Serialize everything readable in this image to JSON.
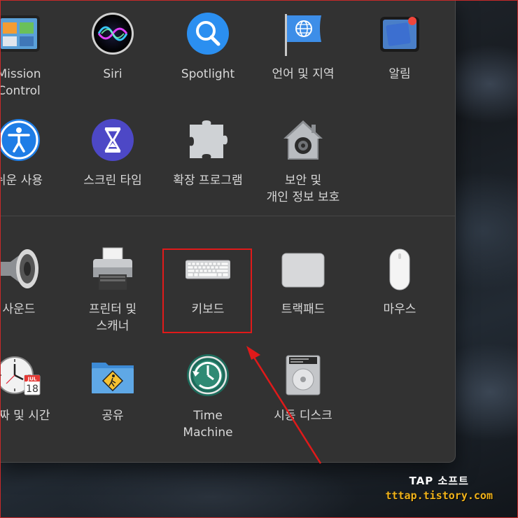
{
  "panes_row1": [
    {
      "label": "Mission\nControl",
      "icon": "mission-control-icon"
    },
    {
      "label": "Siri",
      "icon": "siri-icon"
    },
    {
      "label": "Spotlight",
      "icon": "spotlight-icon"
    },
    {
      "label": "언어 및 지역",
      "icon": "language-region-icon"
    },
    {
      "label": "알림",
      "icon": "notifications-icon"
    }
  ],
  "panes_row2": [
    {
      "label": "쉬운 사용",
      "icon": "accessibility-icon"
    },
    {
      "label": "스크린 타임",
      "icon": "screen-time-icon"
    },
    {
      "label": "확장 프로그램",
      "icon": "extensions-icon"
    },
    {
      "label": "보안 및\n개인 정보 보호",
      "icon": "security-privacy-icon"
    }
  ],
  "panes_row3": [
    {
      "label": "사운드",
      "icon": "sound-icon"
    },
    {
      "label": "프린터 및\n스캐너",
      "icon": "printer-scanner-icon"
    },
    {
      "label": "키보드",
      "icon": "keyboard-icon"
    },
    {
      "label": "트랙패드",
      "icon": "trackpad-icon"
    },
    {
      "label": "마우스",
      "icon": "mouse-icon"
    }
  ],
  "panes_row4": [
    {
      "label": "날짜 및 시간",
      "icon": "date-time-icon",
      "calendar_month": "JUL",
      "calendar_day": "18"
    },
    {
      "label": "공유",
      "icon": "sharing-icon"
    },
    {
      "label": "Time\nMachine",
      "icon": "time-machine-icon"
    },
    {
      "label": "시동 디스크",
      "icon": "startup-disk-icon"
    }
  ],
  "annotation": {
    "highlight_color": "#e01a1a",
    "target": "키보드"
  },
  "watermark": {
    "title": "TAP 소프트",
    "url": "tttap.tistory.com"
  }
}
